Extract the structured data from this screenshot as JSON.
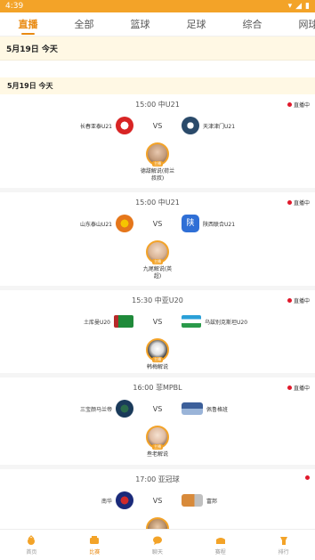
{
  "status": {
    "time": "4:39"
  },
  "tabs": [
    "直播",
    "全部",
    "篮球",
    "足球",
    "综合",
    "网球"
  ],
  "date_sticky": "5月19日  今天",
  "date_row": "5月19日  今天",
  "live_label": "直播中",
  "vs_label": "VS",
  "matches": [
    {
      "time": "15:00 中U21",
      "home": "长春亚泰U21",
      "away": "天津津门U21",
      "anchor": "德甜解说(荷兰叔叔)",
      "badge": "主播"
    },
    {
      "time": "15:00 中U21",
      "home": "山东泰山U21",
      "away": "陕西联合U21",
      "anchor": "九尾解说(英超)",
      "badge": "主播"
    },
    {
      "time": "15:30 中亚U20",
      "home": "土库曼U20",
      "away": "乌兹别克斯坦U20",
      "anchor": "韩梅解说",
      "badge": "主播"
    },
    {
      "time": "16:00 菲MPBL",
      "home": "三宝颜马兰帝",
      "away": "佩鲁格班",
      "anchor": "叁老解说",
      "badge": "主播"
    },
    {
      "time": "17:00 亚冠球",
      "home": "南华",
      "away": "富邦",
      "anchor": "",
      "badge": "主播"
    }
  ],
  "nav": [
    {
      "label": "首页",
      "icon": "home-icon"
    },
    {
      "label": "比赛",
      "icon": "match-icon"
    },
    {
      "label": "聊天",
      "icon": "chat-icon"
    },
    {
      "label": "赛程",
      "icon": "schedule-icon"
    },
    {
      "label": "排行",
      "icon": "rank-icon"
    }
  ],
  "colors": {
    "accent": "#f3a328",
    "active": "#e98a12",
    "live": "#e0192b"
  }
}
